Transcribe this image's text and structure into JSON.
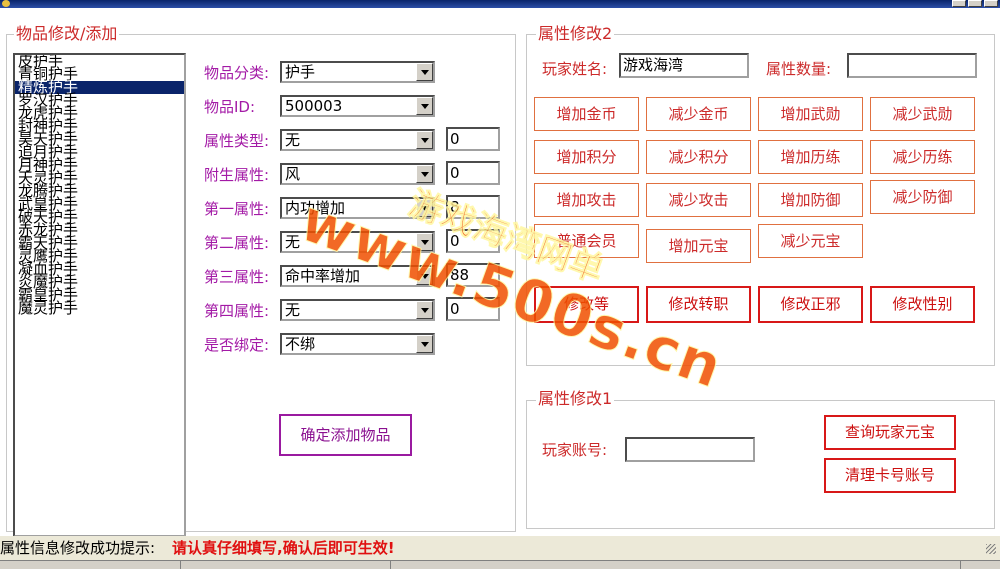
{
  "window": {
    "accent": "#0a246a"
  },
  "add_panel": {
    "legend": "物品修改/添加",
    "items": [
      "皮护手",
      "青铜护手",
      "精炼护手",
      "罗汉护手",
      "龙虎护手",
      "封神护手",
      "昊天护手",
      "追月护手",
      "月神护手",
      "天灵护手",
      "龙腾护手",
      "武皇护手",
      "破天护手",
      "赤龙护手",
      "霸天护手",
      "灵鹰护手",
      "凝血护手",
      "炎魔护手",
      "霸皇护手",
      "魔灵护手"
    ],
    "selected_index": 2,
    "fields": {
      "category": {
        "label": "物品分类:",
        "value": "护手"
      },
      "item_id": {
        "label": "物品ID:",
        "value": "500003"
      },
      "attr_type": {
        "label": "属性类型:",
        "value": "无",
        "num": "0"
      },
      "extra_attr": {
        "label": "附生属性:",
        "value": "风",
        "num": "0"
      },
      "attr1": {
        "label": "第一属性:",
        "value": "内功增加",
        "num": "8"
      },
      "attr2": {
        "label": "第二属性:",
        "value": "无",
        "num": "0"
      },
      "attr3": {
        "label": "第三属性:",
        "value": "命中率增加",
        "num": "88"
      },
      "attr4": {
        "label": "第四属性:",
        "value": "无",
        "num": "0"
      },
      "bound": {
        "label": "是否绑定:",
        "value": "不绑"
      }
    },
    "confirm_button": "确定添加物品"
  },
  "attr2_panel": {
    "legend": "属性修改2",
    "player_name_label": "玩家姓名:",
    "player_name_value": "游戏海湾",
    "attr_count_label": "属性数量:",
    "attr_count_value": "",
    "buttons": [
      "增加金币",
      "减少金币",
      "增加武勋",
      "减少武勋",
      "增加积分",
      "减少积分",
      "增加历练",
      "减少历练",
      "增加攻击",
      "减少攻击",
      "增加防御",
      "减少防御",
      "普通会员",
      "增加元宝",
      "减少元宝"
    ],
    "red_buttons": [
      "修改等",
      "修改转职",
      "修改正邪",
      "修改性别"
    ]
  },
  "attr1_panel": {
    "legend": "属性修改1",
    "account_label": "玩家账号:",
    "account_value": "",
    "query_button": "查询玩家元宝",
    "clear_button": "清理卡号账号"
  },
  "status": {
    "label": "属性信息修改成功提示:",
    "message": "请认真仔细填写,确认后即可生效!",
    "message_color": "#e01010"
  },
  "watermark": {
    "line1": "游戏海湾网单",
    "line2": "www.500s.cn",
    "color": "#f05000"
  }
}
